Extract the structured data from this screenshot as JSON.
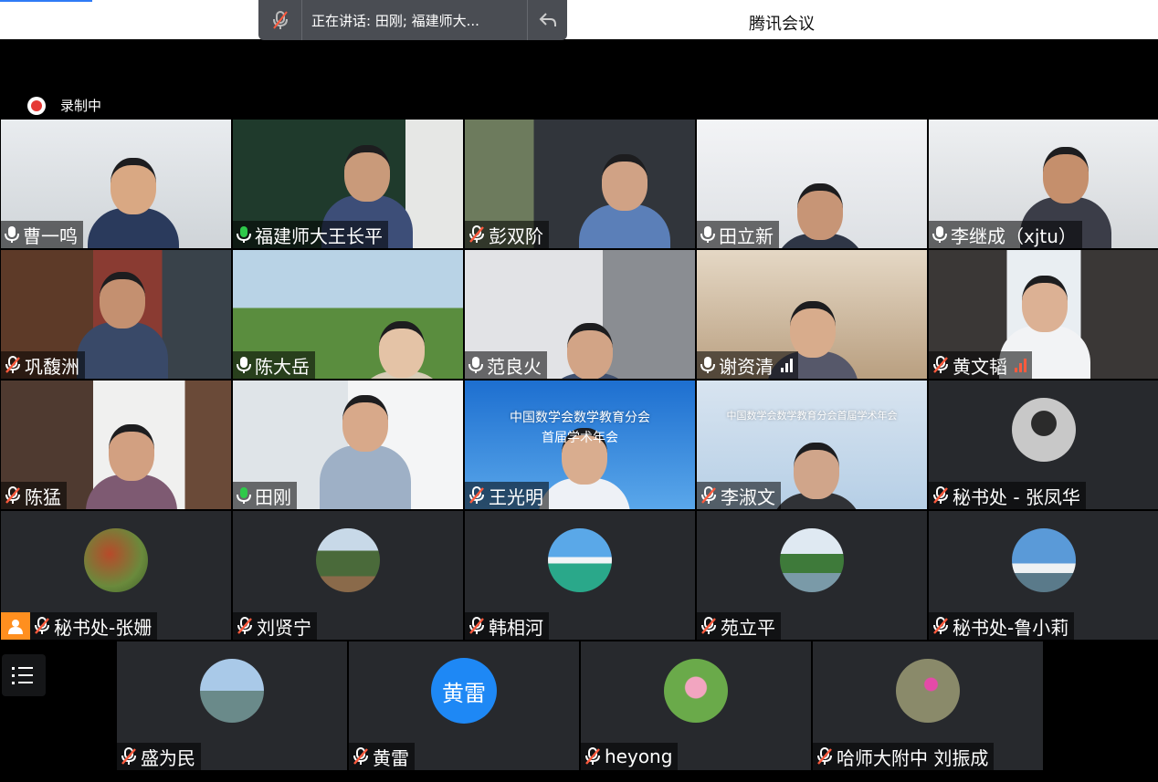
{
  "window": {
    "title": "腾讯会议"
  },
  "speaking": {
    "label": "正在讲话: 田刚; 福建师大..."
  },
  "recording": {
    "label": "录制中"
  },
  "participants": [
    {
      "name": "曹一鸣",
      "mic": "on"
    },
    {
      "name": "福建师大王长平",
      "mic": "active"
    },
    {
      "name": "彭双阶",
      "mic": "muted"
    },
    {
      "name": "田立新",
      "mic": "on"
    },
    {
      "name": "李继成（xjtu）",
      "mic": "on"
    },
    {
      "name": "巩馥洲",
      "mic": "muted"
    },
    {
      "name": "陈大岳",
      "mic": "on"
    },
    {
      "name": "范良火",
      "mic": "on"
    },
    {
      "name": "谢资清",
      "mic": "on",
      "signal": "good"
    },
    {
      "name": "黄文韬",
      "mic": "muted",
      "signal": "weak"
    },
    {
      "name": "陈猛",
      "mic": "muted"
    },
    {
      "name": "田刚",
      "mic": "active"
    },
    {
      "name": "王光明",
      "mic": "muted",
      "banner_title": "中国数学会数学教育分会",
      "banner_sub": "首届学术年会"
    },
    {
      "name": "李淑文",
      "mic": "muted",
      "banner_title": "中国数学会数学教育分会首届学术年会"
    },
    {
      "name": "秘书处 - 张凤华",
      "mic": "muted"
    },
    {
      "name": "秘书处-张姗",
      "mic": "muted",
      "host": true
    },
    {
      "name": "刘贤宁",
      "mic": "muted"
    },
    {
      "name": "韩相河",
      "mic": "muted"
    },
    {
      "name": "苑立平",
      "mic": "muted"
    },
    {
      "name": "秘书处-鲁小莉",
      "mic": "muted"
    },
    {
      "name": "盛为民",
      "mic": "muted"
    },
    {
      "name": "黄雷",
      "mic": "muted",
      "avatar_text": "黄雷"
    },
    {
      "name": "heyong",
      "mic": "muted"
    },
    {
      "name": "哈师大附中  刘振成",
      "mic": "muted"
    }
  ],
  "colors": {
    "accent": "#2f7bf6",
    "active_border": "#2ec94a",
    "muted_icon": "#ff5a3d",
    "avatar_bg": "#1e88f5",
    "host_badge": "#ff8f1f"
  }
}
